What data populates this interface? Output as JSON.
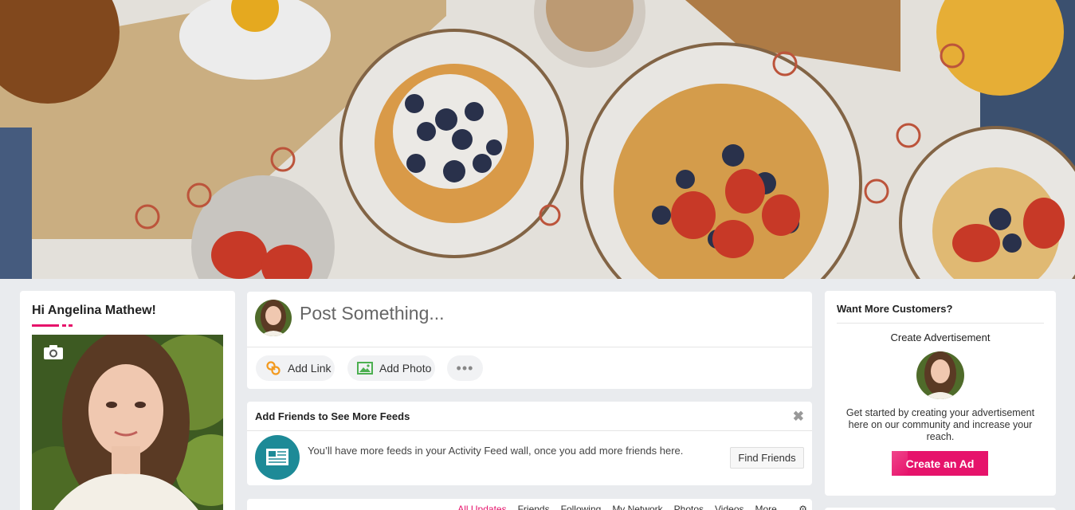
{
  "profile": {
    "greeting": "Hi Angelina Mathew!"
  },
  "composer": {
    "placeholder": "Post Something...",
    "actions": [
      {
        "label": "Add Link",
        "icon": "link-icon"
      },
      {
        "label": "Add Photo",
        "icon": "photo-icon"
      },
      {
        "label": "•••",
        "icon": "more-icon"
      }
    ]
  },
  "friends_card": {
    "title": "Add Friends to See More Feeds",
    "close_label": "✖",
    "message": "You’ll have more feeds in your Activity Feed wall, once you add more friends here.",
    "button_label": "Find Friends"
  },
  "feed_tabs": {
    "items": [
      "All Updates",
      "Friends",
      "Following",
      "My Network",
      "Photos",
      "Videos",
      "More ⌄"
    ],
    "active": "All Updates"
  },
  "ad": {
    "title": "Want More Customers?",
    "subtitle": "Create Advertisement",
    "description": "Get started by creating your advertisement here on our community and increase your reach.",
    "button_label": "Create an Ad"
  },
  "colors": {
    "accent": "#e6136b",
    "teal": "#1d8a97",
    "background": "#e9ebee"
  }
}
